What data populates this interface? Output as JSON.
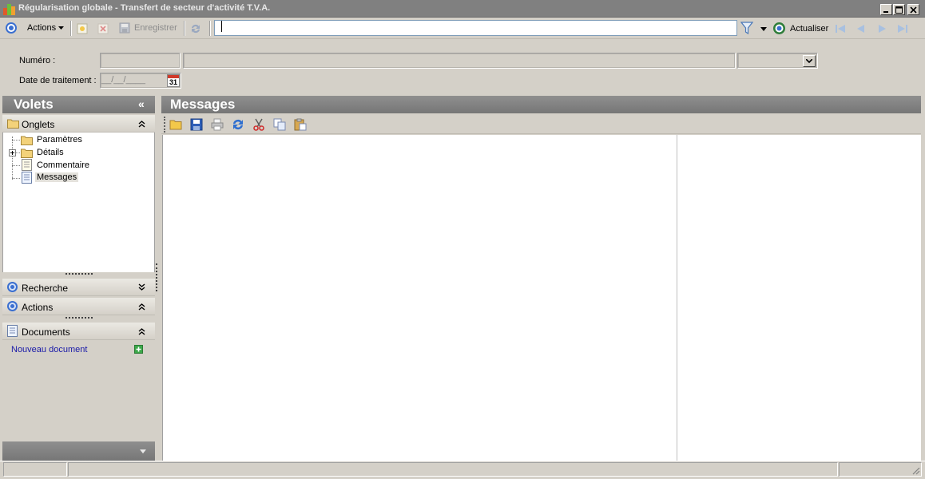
{
  "window": {
    "title": "Régularisation globale - Transfert de secteur d'activité T.V.A.",
    "buttons": [
      "minimize-icon",
      "maximize-icon",
      "close-icon"
    ]
  },
  "toolbar": {
    "actions_label": "Actions",
    "save_label": "Enregistrer",
    "search_value": "",
    "refresh_label": "Actualiser"
  },
  "form": {
    "numero_label": "Numéro :",
    "numero_value": "",
    "date_label": "Date de traitement :",
    "date_value": "__/__/____",
    "calendar_day": "31"
  },
  "volets": {
    "title": "Volets",
    "collapse_glyph": "«",
    "onglets": {
      "label": "Onglets",
      "items": [
        {
          "label": "Paramètres",
          "icon": "folder-icon"
        },
        {
          "label": "Détails",
          "icon": "folder-icon"
        },
        {
          "label": "Commentaire",
          "icon": "document-icon"
        },
        {
          "label": "Messages",
          "icon": "document-icon"
        }
      ]
    },
    "recherche_label": "Recherche",
    "actions_label": "Actions",
    "documents": {
      "label": "Documents",
      "new_link": "Nouveau document"
    }
  },
  "messages": {
    "title": "Messages"
  },
  "colors": {
    "panel_header": "#808080",
    "link": "#1a1aa8",
    "face": "#d4d0c8"
  }
}
